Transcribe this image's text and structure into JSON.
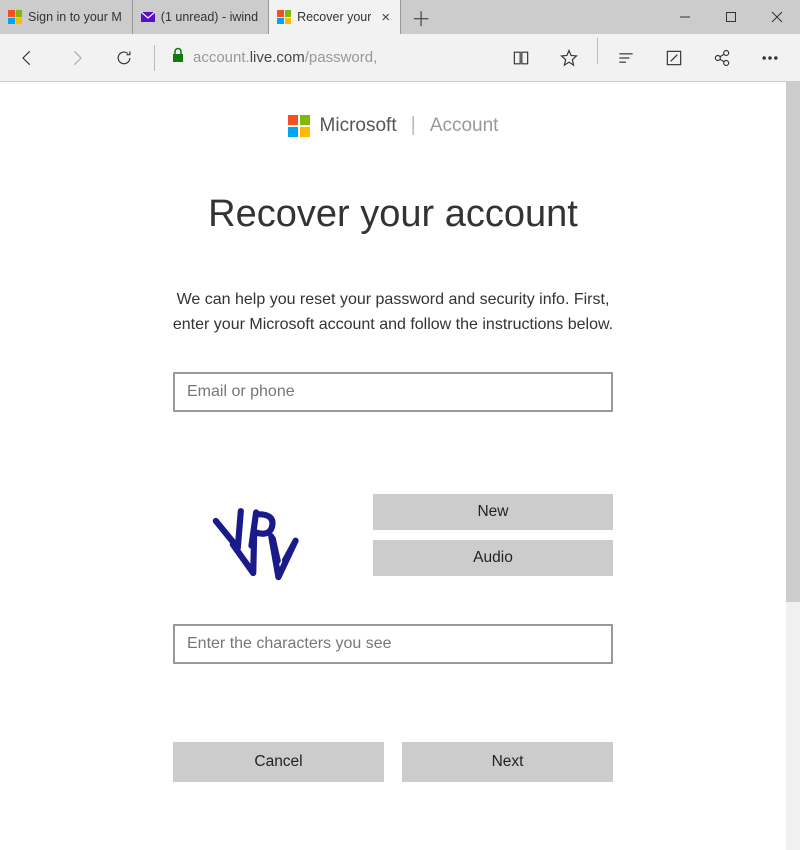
{
  "tabs": [
    {
      "label": "Sign in to your M"
    },
    {
      "label": "(1 unread) - iwind"
    },
    {
      "label": "Recover your"
    }
  ],
  "address": {
    "host": "live.com",
    "prefix": "account.",
    "suffix": "/password,"
  },
  "brand": {
    "name": "Microsoft",
    "sub": "Account"
  },
  "page": {
    "heading": "Recover your account",
    "prompt": "We can help you reset your password and security info. First, enter your Microsoft account and follow the instructions below.",
    "email_placeholder": "Email or phone",
    "captcha_placeholder": "Enter the characters you see",
    "captcha_new": "New",
    "captcha_audio": "Audio",
    "cancel": "Cancel",
    "next": "Next"
  }
}
